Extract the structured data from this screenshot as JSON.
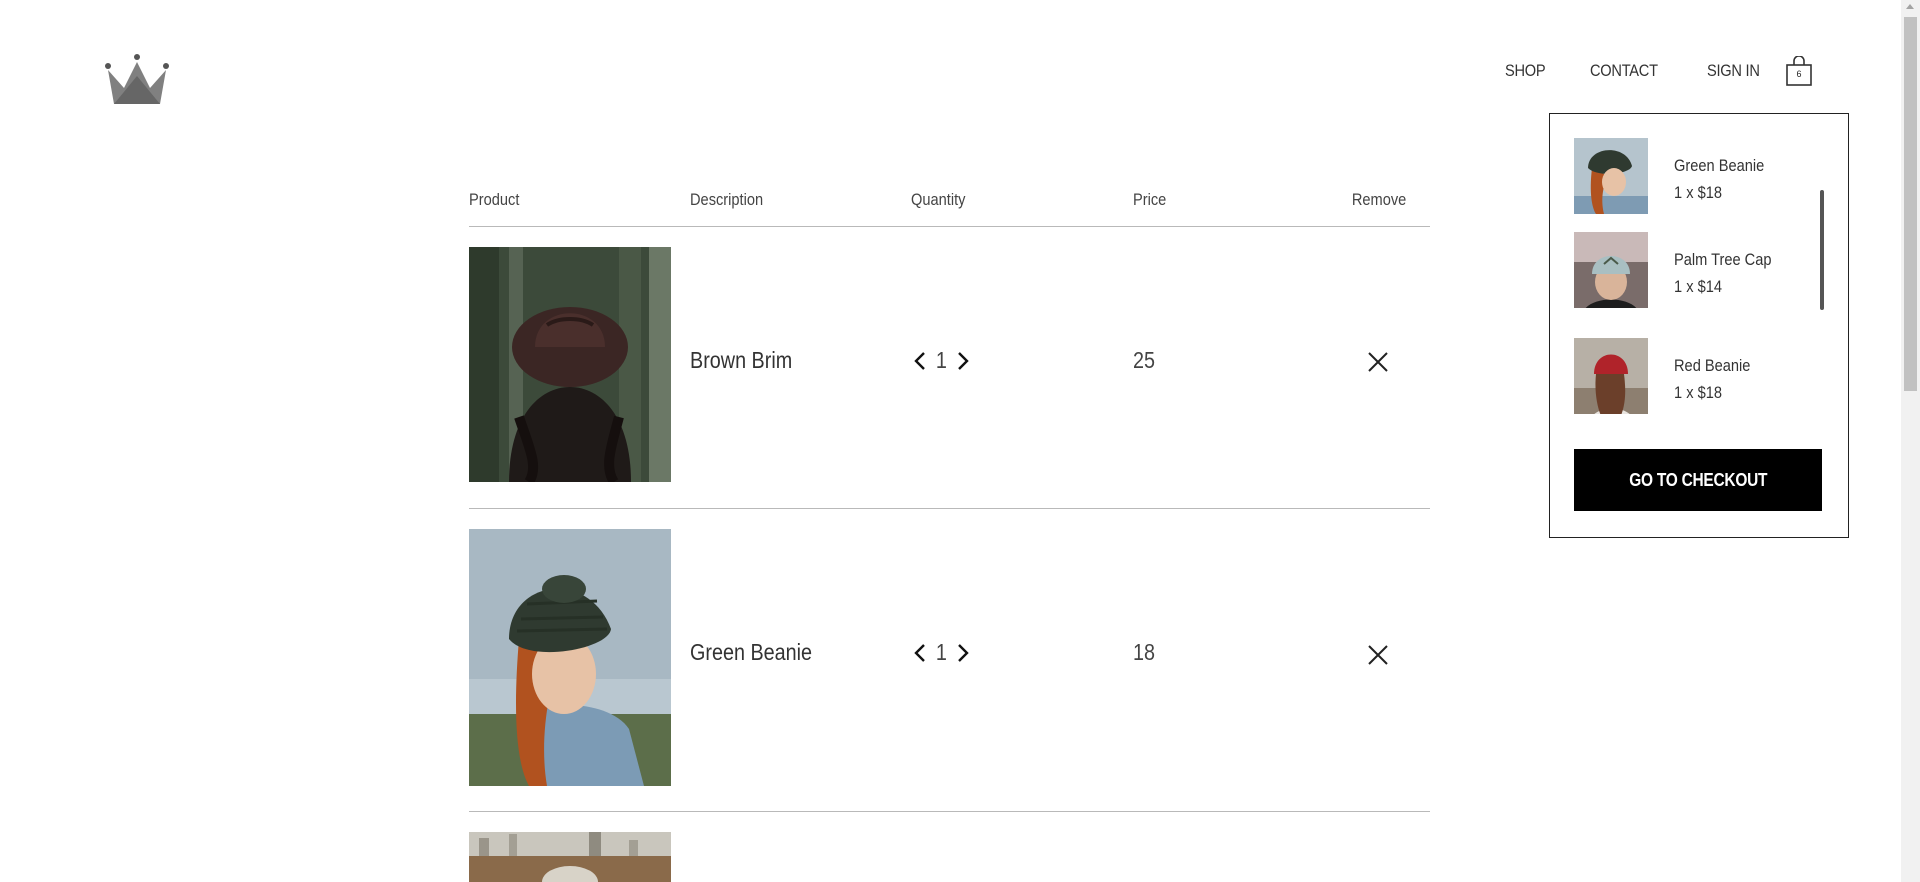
{
  "header": {
    "logo_icon": "crown-icon",
    "nav": [
      {
        "label": "SHOP"
      },
      {
        "label": "CONTACT"
      },
      {
        "label": "SIGN IN"
      }
    ],
    "cart": {
      "icon": "shopping-bag-icon",
      "count": "6"
    }
  },
  "table": {
    "headers": {
      "product": "Product",
      "description": "Description",
      "quantity": "Quantity",
      "price": "Price",
      "remove": "Remove"
    },
    "rows": [
      {
        "image": "brown-brim-photo",
        "description": "Brown Brim",
        "quantity": "1",
        "price": "25"
      },
      {
        "image": "green-beanie-photo",
        "description": "Green Beanie",
        "quantity": "1",
        "price": "18"
      },
      {
        "image": "city-photo"
      }
    ]
  },
  "minicart": {
    "items": [
      {
        "name": "Green Beanie",
        "qty_price": "1 x $18",
        "image": "green-beanie-thumb"
      },
      {
        "name": "Palm Tree Cap",
        "qty_price": "1 x $14",
        "image": "palm-tree-cap-thumb"
      },
      {
        "name": "Red Beanie",
        "qty_price": "1 x $18",
        "image": "red-beanie-thumb"
      }
    ],
    "checkout_label": "GO TO CHECKOUT"
  },
  "colors": {
    "accent": "#000000",
    "divider": "#b9b9b9",
    "text": "#333333"
  }
}
